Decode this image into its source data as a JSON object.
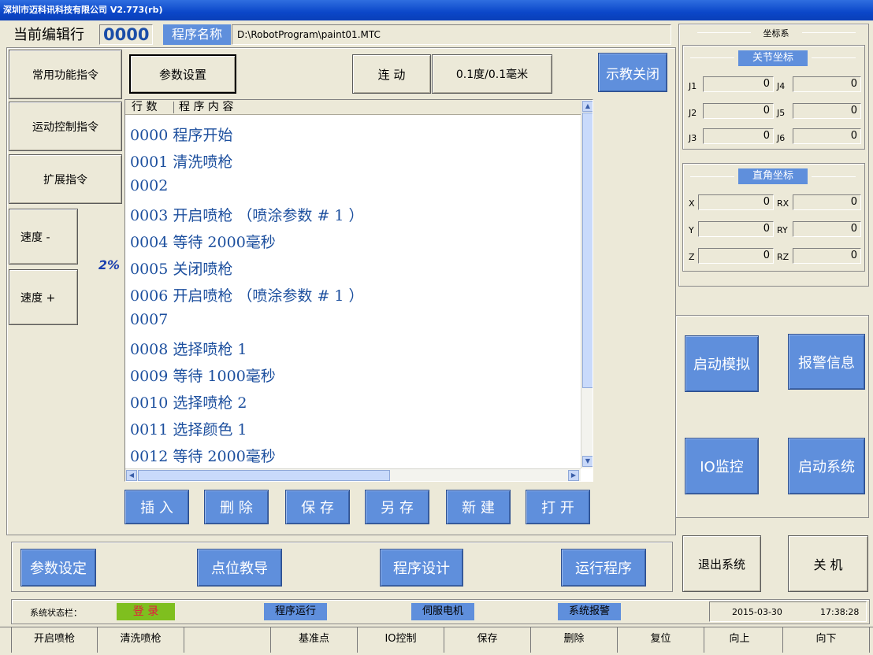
{
  "window": {
    "title": "深圳市迈科讯科技有限公司 V2.773(rb)"
  },
  "header": {
    "edit_line_label": "当前编辑行",
    "edit_line_value": "0000",
    "program_name_label": "程序名称",
    "program_path": "D:\\RobotProgram\\paint01.MTC"
  },
  "toolbar": {
    "param_settings": "参数设置",
    "link_mode": "连 动",
    "step_unit": "0.1度/0.1毫米",
    "teach_close": "示教关闭"
  },
  "left_menu": {
    "common_cmds": "常用功能指令",
    "motion_cmds": "运动控制指令",
    "ext_cmds": "扩展指令",
    "speed_down": "速度 -",
    "speed_value": "2%",
    "speed_up": "速度 +"
  },
  "program": {
    "col_line": "行 数",
    "col_content": "程 序 内 容",
    "lines": [
      "0000 程序开始",
      "0001 清洗喷枪",
      "0002",
      "0003 开启喷枪 （喷涂参数 # 1 ）",
      "0004 等待 2000毫秒",
      "0005 关闭喷枪",
      "0006 开启喷枪 （喷涂参数 # 1 ）",
      "0007",
      "0008 选择喷枪 1",
      "0009 等待 1000毫秒",
      "0010 选择喷枪 2",
      "0011 选择颜色 1",
      "0012 等待 2000毫秒"
    ]
  },
  "edit_buttons": {
    "insert": "插 入",
    "delete": "删 除",
    "save": "保 存",
    "save_as": "另 存",
    "new": "新 建",
    "open": "打 开"
  },
  "coords": {
    "title": "坐标系",
    "joint_title": "关节坐标",
    "joint_labels": [
      "J1",
      "J4",
      "J2",
      "J5",
      "J3",
      "J6"
    ],
    "joint_values": [
      "0",
      "0",
      "0",
      "0",
      "0",
      "0"
    ],
    "cart_title": "直角坐标",
    "cart_labels": [
      "X",
      "RX",
      "Y",
      "RY",
      "Z",
      "RZ"
    ],
    "cart_values": [
      "0",
      "0",
      "0",
      "0",
      "0",
      "0"
    ]
  },
  "right_buttons": {
    "start_sim": "启动模拟",
    "alarm_info": "报警信息",
    "io_monitor": "IO监控",
    "start_system": "启动系统",
    "exit_system": "退出系统",
    "shutdown": "关 机"
  },
  "modes": {
    "param_set": "参数设定",
    "point_teach": "点位教导",
    "program_design": "程序设计",
    "run_program": "运行程序"
  },
  "status": {
    "label": "系统状态栏：",
    "login": "登 录",
    "program_run": "程序运行",
    "servo_motor": "伺服电机",
    "system_alarm": "系统报警",
    "date": "2015-03-30",
    "time": "17:38:28"
  },
  "fkeys": [
    "开启喷枪",
    "清洗喷枪",
    "",
    "基准点",
    "IO控制",
    "保存",
    "删除",
    "复位",
    "向上",
    "向下"
  ],
  "colors": {
    "accent_blue": "#5f8fdc",
    "login_green": "#7fbf1f",
    "text_blue": "#1c4f9e"
  }
}
